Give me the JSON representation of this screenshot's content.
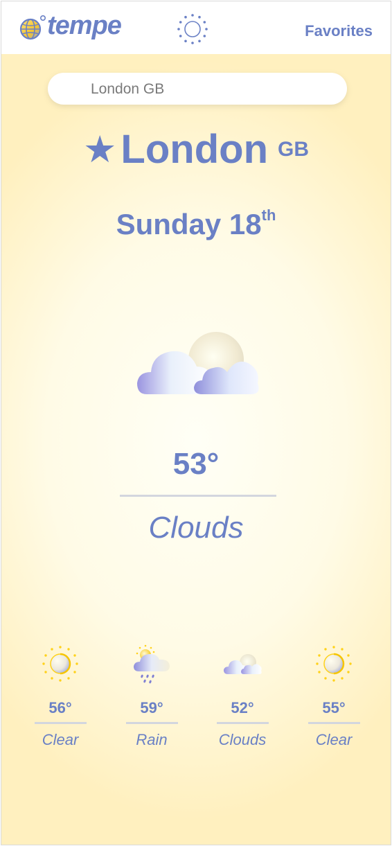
{
  "app": {
    "name": "tempe"
  },
  "header": {
    "favorites_label": "Favorites"
  },
  "search": {
    "value": "London GB",
    "placeholder": ""
  },
  "location": {
    "city": "London",
    "country": "GB"
  },
  "date": {
    "day": "Sunday 18",
    "suffix": "th"
  },
  "current": {
    "temperature": "53°",
    "condition": "Clouds",
    "icon": "clouds-icon"
  },
  "forecast": [
    {
      "temperature": "56°",
      "condition": "Clear",
      "icon": "sun-icon"
    },
    {
      "temperature": "59°",
      "condition": "Rain",
      "icon": "rain-icon"
    },
    {
      "temperature": "52°",
      "condition": "Clouds",
      "icon": "clouds-icon"
    },
    {
      "temperature": "55°",
      "condition": "Clear",
      "icon": "sun-icon"
    }
  ],
  "colors": {
    "accent": "#6a80c5",
    "background_top": "#fff0bf",
    "background_center": "#fffff6",
    "sun": "#ffd21a",
    "divider": "#d3d6de"
  }
}
